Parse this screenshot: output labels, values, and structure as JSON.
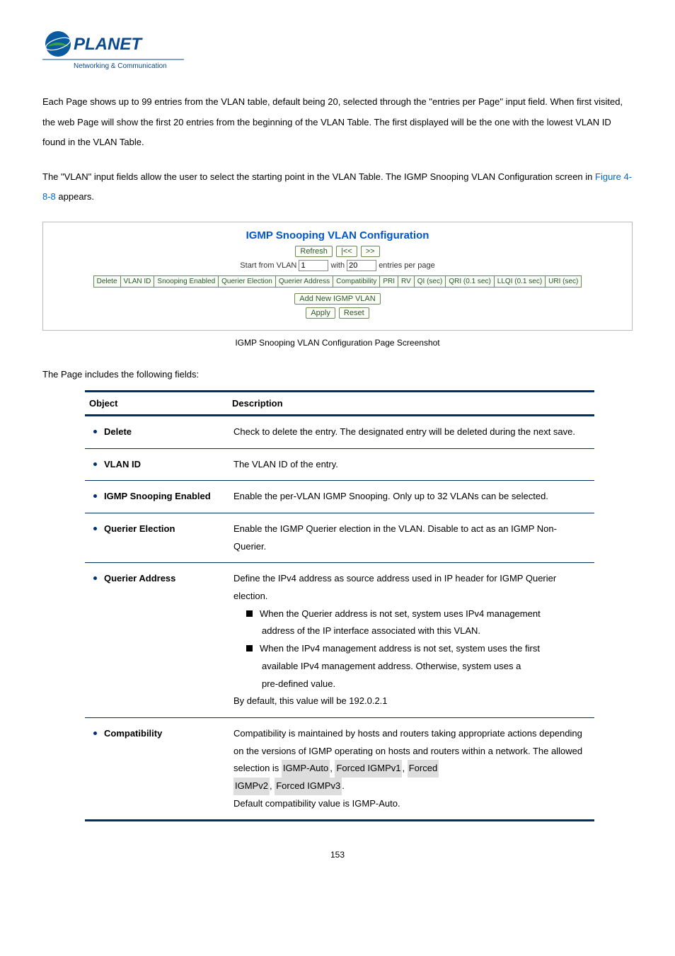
{
  "logo": {
    "brand": "PLANET",
    "tagline": "Networking & Communication"
  },
  "para1": "Each Page shows up to 99 entries from the VLAN table, default being 20, selected through the \"entries per Page\" input field. When first visited, the web Page will show the first 20 entries from the beginning of the VLAN Table. The first displayed will be the one with the lowest VLAN ID found in the VLAN Table.",
  "para2_a": "The \"VLAN\" input fields allow the user to select the starting point in the VLAN Table. The IGMP Snooping VLAN Configuration screen in ",
  "para2_link": "Figure 4-8-8",
  "para2_b": " appears.",
  "screenshot": {
    "title": "IGMP Snooping VLAN Configuration",
    "btn_refresh": "Refresh",
    "btn_prev": "|<<",
    "btn_next": ">>",
    "start_label_a": "Start from VLAN ",
    "start_value": "1",
    "start_label_b": " with ",
    "per_page_value": "20",
    "start_label_c": " entries per page",
    "cols": [
      "Delete",
      "VLAN ID",
      "Snooping Enabled",
      "Querier Election",
      "Querier Address",
      "Compatibility",
      "PRI",
      "RV",
      "QI (sec)",
      "QRI (0.1 sec)",
      "LLQI (0.1 sec)",
      "URI (sec)"
    ],
    "btn_add": "Add New IGMP VLAN",
    "btn_apply": "Apply",
    "btn_reset": "Reset"
  },
  "caption": "IGMP Snooping VLAN Configuration Page Screenshot",
  "fields_intro": "The Page includes the following fields:",
  "table": {
    "head_obj": "Object",
    "head_desc": "Description",
    "rows": [
      {
        "obj": "Delete",
        "desc": "Check to delete the entry. The designated entry will be deleted during the next save."
      },
      {
        "obj": "VLAN ID",
        "desc": "The VLAN ID of the entry."
      },
      {
        "obj": "IGMP Snooping Enabled",
        "desc": "Enable the per-VLAN IGMP Snooping. Only up to 32 VLANs can be selected."
      },
      {
        "obj": "Querier Election",
        "desc": "Enable the IGMP Querier election in the VLAN. Disable to act as an IGMP Non-Querier."
      },
      {
        "obj": "Querier Address",
        "desc_lead": "Define the IPv4 address as source address used in IP header for IGMP Querier election.",
        "sq1a": "When the Querier address is not set, system uses IPv4 management",
        "sq1b": "address of the IP interface associated with this VLAN.",
        "sq2a": "When the IPv4 management address is not set, system uses the first",
        "sq2b": "available IPv4 management address. Otherwise, system uses a",
        "sq2c": "pre-defined value.",
        "desc_tail": "By default, this value will be 192.0.2.1"
      },
      {
        "obj": "Compatibility",
        "c_lead": "Compatibility is maintained by hosts and routers taking appropriate actions depending on the versions of IGMP operating on hosts and routers within a network. The allowed selection is ",
        "opt1": "IGMP-Auto",
        "opt2": "Forced IGMPv1",
        "opt3": "Forced",
        "opt4": "IGMPv2",
        "opt5": "Forced IGMPv3",
        "c_mid": ", ",
        "c_end": ".",
        "c_def_a": "Default compatibility value is ",
        "c_def_val": "IGMP-Auto",
        "c_def_b": "."
      }
    ]
  },
  "page_number": "153"
}
